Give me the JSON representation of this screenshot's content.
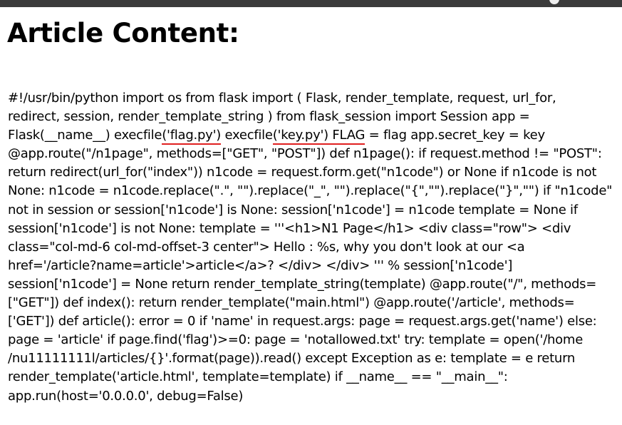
{
  "page": {
    "title": "Article Content:"
  },
  "article": {
    "lines": [
      "#!/usr/bin/python import os from flask import ( Flask, render_template, request, url_for,",
      "redirect, session, render_template_string ) from flask_session import Session app =",
      {
        "pre": "Flask(__name__) execfile",
        "u1": "('flag.py')",
        "mid": " execfile",
        "u2": "('key.py') FLAG",
        "post": " = flag app.secret_key = key"
      },
      "@app.route(\"/n1page\", methods=[\"GET\", \"POST\"]) def n1page(): if request.method != \"POST\":",
      "return redirect(url_for(\"index\")) n1code = request.form.get(\"n1code\") or None if n1code is not",
      "None: n1code = n1code.replace(\".\", \"\").replace(\"_\", \"\").replace(\"{\",\"\").replace(\"}\",\"\") if \"n1code\"",
      "not in session or session['n1code'] is None: session['n1code'] = n1code template = None if",
      "session['n1code'] is not None: template = '''<h1>N1 Page</h1> <div class=\"row\"> <div",
      "class=\"col-md-6 col-md-offset-3 center\"> Hello : %s, why you don't look at our <a",
      "href='/article?name=article'>article</a>? </div> </div> ''' % session['n1code']",
      "session['n1code'] = None return render_template_string(template) @app.route(\"/\", methods=",
      "[\"GET\"]) def index(): return render_template(\"main.html\") @app.route('/article', methods=",
      "['GET']) def article(): error = 0 if 'name' in request.args: page = request.args.get('name') else:",
      "page = 'article' if page.find('flag')>=0: page = 'notallowed.txt' try: template = open('/home",
      "/nu11111111l/articles/{}'.format(page)).read() except Exception as e: template = e return",
      "render_template('article.html', template=template) if __name__ == \"__main__\":",
      "app.run(host='0.0.0.0', debug=False)"
    ]
  },
  "colors": {
    "underline": "#e02020",
    "topbar": "#3b3b3b"
  }
}
